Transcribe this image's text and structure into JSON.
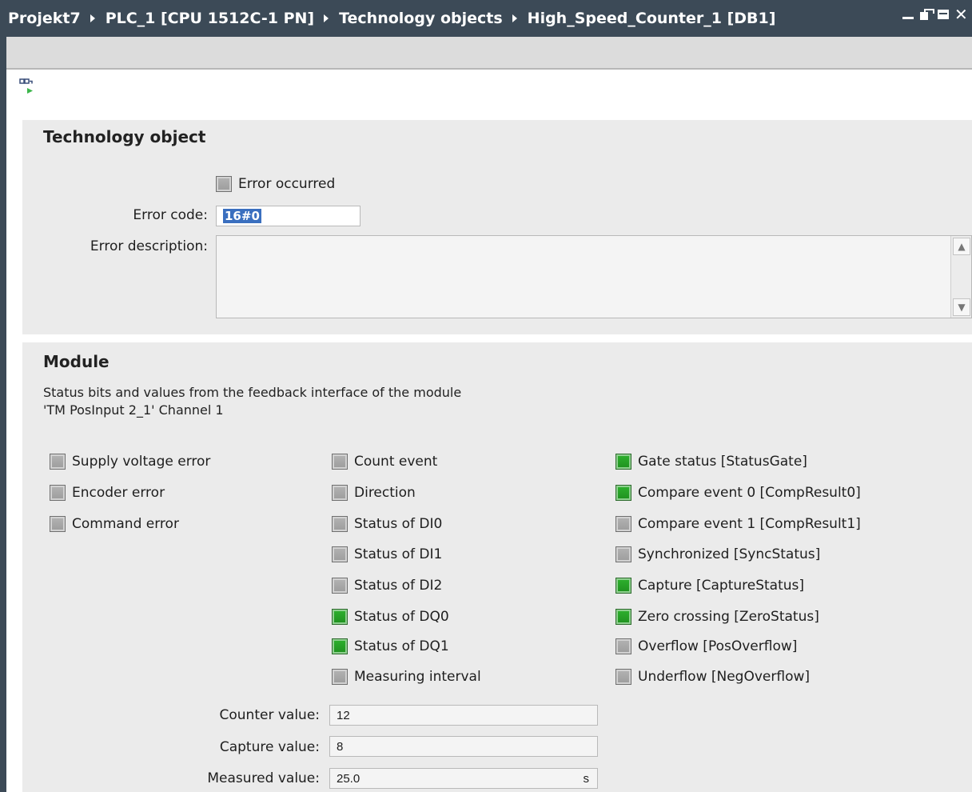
{
  "titlebar": {
    "breadcrumbs": [
      "Projekt7",
      "PLC_1 [CPU 1512C-1 PN]",
      "Technology objects",
      "High_Speed_Counter_1 [DB1]"
    ],
    "close_glyph": "✕"
  },
  "icons": {
    "window_minimize": "minimize-icon",
    "window_float": "float-window-icon",
    "window_maximize": "maximize-icon",
    "window_close": "close-icon",
    "technology_object": "technology-object-icon",
    "scroll_up": "▲",
    "scroll_down": "▼"
  },
  "colors": {
    "titlebar": "#3c4a57",
    "led_on": "#1f9a1f",
    "led_off": "#a6a6a6",
    "selection": "#3a6fbf"
  },
  "technology_object": {
    "title": "Technology object",
    "error_occurred": {
      "label": "Error occurred",
      "active": false
    },
    "error_code_label": "Error code:",
    "error_code_value": "16#0",
    "error_description_label": "Error description:",
    "error_description_value": ""
  },
  "module": {
    "title": "Module",
    "description_line1": "Status bits and values from the feedback interface of the module",
    "description_line2": "'TM PosInput 2_1' Channel 1",
    "col1": [
      {
        "label": "Supply voltage error",
        "active": false
      },
      {
        "label": "Encoder error",
        "active": false
      },
      {
        "label": "Command error",
        "active": false
      }
    ],
    "col2": [
      {
        "label": "Count event",
        "active": false
      },
      {
        "label": "Direction",
        "active": false
      },
      {
        "label": "Status of DI0",
        "active": false
      },
      {
        "label": "Status of DI1",
        "active": false
      },
      {
        "label": "Status of DI2",
        "active": false
      },
      {
        "label": "Status of DQ0",
        "active": true
      },
      {
        "label": "Status of DQ1",
        "active": true
      },
      {
        "label": "Measuring interval",
        "active": false
      }
    ],
    "col3": [
      {
        "label": "Gate status [StatusGate]",
        "active": true
      },
      {
        "label": "Compare event 0 [CompResult0]",
        "active": true
      },
      {
        "label": "Compare event 1 [CompResult1]",
        "active": false
      },
      {
        "label": "Synchronized [SyncStatus]",
        "active": false
      },
      {
        "label": "Capture [CaptureStatus]",
        "active": true
      },
      {
        "label": "Zero crossing [ZeroStatus]",
        "active": true
      },
      {
        "label": "Overflow [PosOverflow]",
        "active": false
      },
      {
        "label": "Underflow [NegOverflow]",
        "active": false
      }
    ],
    "counter_value_label": "Counter value:",
    "counter_value": "12",
    "capture_value_label": "Capture value:",
    "capture_value": "8",
    "measured_value_label": "Measured value:",
    "measured_value": "25.0",
    "measured_unit": "s"
  }
}
